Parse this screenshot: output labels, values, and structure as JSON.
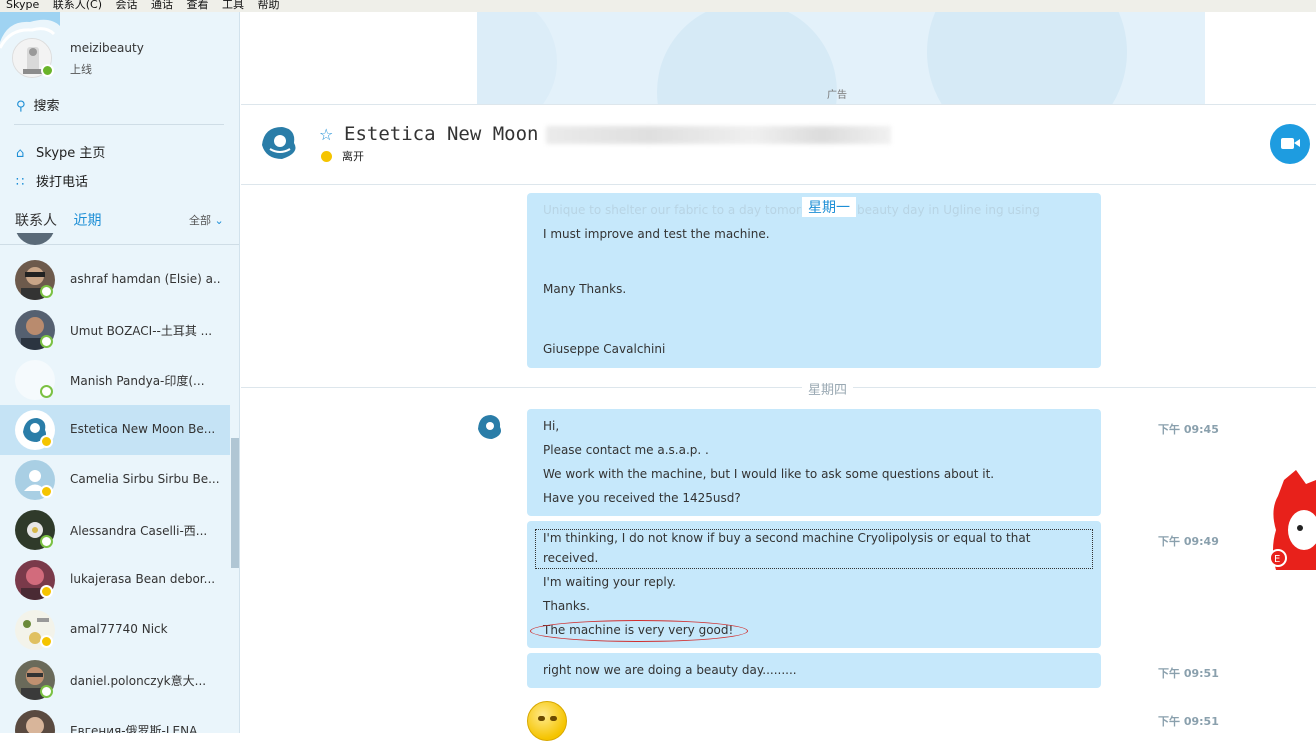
{
  "menu": [
    "Skype",
    "联系人(C)",
    "会话",
    "通话",
    "查看",
    "工具",
    "帮助"
  ],
  "profile": {
    "name": "meizibeauty",
    "status": "上线"
  },
  "sidebar": {
    "search_label": "搜索",
    "home_label": "Skype 主页",
    "call_label": "拨打电话",
    "tab_contacts": "联系人",
    "tab_recent": "近期",
    "filter_label": "全部"
  },
  "contacts": [
    {
      "name": "ashraf hamdan (Elsie) a...",
      "presence": "online"
    },
    {
      "name": "Umut BOZACI--土耳其 ...",
      "presence": "online"
    },
    {
      "name": "Manish Pandya-印度(...",
      "presence": "online"
    },
    {
      "name": "Estetica New Moon Be...",
      "presence": "away",
      "selected": true
    },
    {
      "name": "Camelia Sirbu Sirbu Be...",
      "presence": "away"
    },
    {
      "name": "Alessandra Caselli-西...",
      "presence": "online"
    },
    {
      "name": "lukajerasa Bean debor...",
      "presence": "away"
    },
    {
      "name": "amal77740 Nick",
      "presence": "away"
    },
    {
      "name": "daniel.polonczyk意大...",
      "presence": "online"
    },
    {
      "name": "Евгения-俄罗斯-LENA",
      "presence": "online"
    }
  ],
  "ad": {
    "label": "广告"
  },
  "chat": {
    "title": "Estetica New Moon",
    "status": "离开",
    "day1": "星期一",
    "day2": "星期四",
    "ghost_line": "Unique to shelter our fabric to a day tomorrow at in beauty day in Ugline ing using",
    "earlier_lines": [
      "I must improve and test the machine.",
      "Many Thanks.",
      "Giuseppe Cavalchini"
    ],
    "messages": [
      {
        "time": "下午 09:45",
        "lines": [
          "Hi,",
          "Please contact me a.s.a.p. .",
          "We work with the machine, but I would like to ask some questions about it.",
          "Have you received the 1425usd?"
        ]
      },
      {
        "time": "下午 09:49",
        "lines": [
          "I'm thinking, I do not know if  buy a second machine Cryolipolysis or equal to that",
          "received.",
          "I'm waiting your reply.",
          "Thanks.",
          "The machine is very very good!"
        ]
      },
      {
        "time": "下午 09:51",
        "lines": [
          "right now we are doing a beauty day........."
        ]
      },
      {
        "time": "下午 09:51",
        "lines": []
      }
    ]
  }
}
